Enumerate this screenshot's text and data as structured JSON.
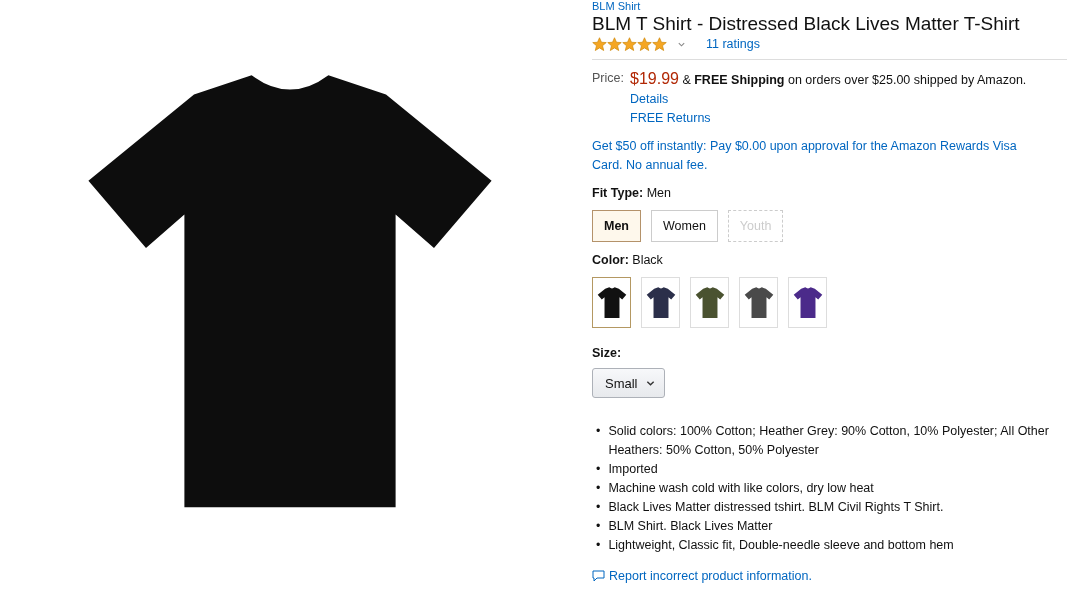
{
  "brand": "BLM Shirt",
  "title": "BLM T Shirt - Distressed Black Lives Matter T-Shirt",
  "rating": {
    "stars": 5,
    "count": "11 ratings"
  },
  "price": {
    "label": "Price:",
    "amount": "$19.99",
    "shipping": "& **FREE Shipping** on orders over $25.00 shipped by Amazon.",
    "details": "Details",
    "returns": "FREE Returns"
  },
  "promo": "Get $50 off instantly: Pay $0.00 upon approval for the Amazon Rewards Visa Card. No annual fee.",
  "fit_type": {
    "label": "Fit Type:",
    "value": "Men",
    "options": [
      {
        "label": "Men",
        "selected": true,
        "disabled": false
      },
      {
        "label": "Women",
        "selected": false,
        "disabled": false
      },
      {
        "label": "Youth",
        "selected": false,
        "disabled": true
      }
    ]
  },
  "color": {
    "label": "Color:",
    "value": "Black",
    "swatches": [
      {
        "color": "#111111",
        "selected": true
      },
      {
        "color": "#2b2f4a",
        "selected": false
      },
      {
        "color": "#4a5230",
        "selected": false
      },
      {
        "color": "#4a4a4a",
        "selected": false
      },
      {
        "color": "#4b2a8a",
        "selected": false
      }
    ]
  },
  "size": {
    "label": "Size:",
    "value": "Small"
  },
  "bullets": [
    {
      "marker": "•",
      "text": "Solid colors: 100% Cotton; Heather Grey: 90% Cotton, 10% Polyester; All Other Heathers: 50% Cotton, 50% Polyester"
    },
    {
      "marker": "•",
      "text": "Imported"
    },
    {
      "marker": "•",
      "text": "Machine wash cold with like colors, dry low heat"
    },
    {
      "marker": "•",
      "text": "Black Lives Matter distressed tshirt. BLM Civil Rights T Shirt."
    },
    {
      "marker": "•",
      "text": "BLM Shirt. Black Lives Matter"
    },
    {
      "marker": "•",
      "text": "Lightweight, Classic fit, Double-needle sleeve and bottom hem"
    }
  ],
  "report_link": "Report incorrect product information."
}
